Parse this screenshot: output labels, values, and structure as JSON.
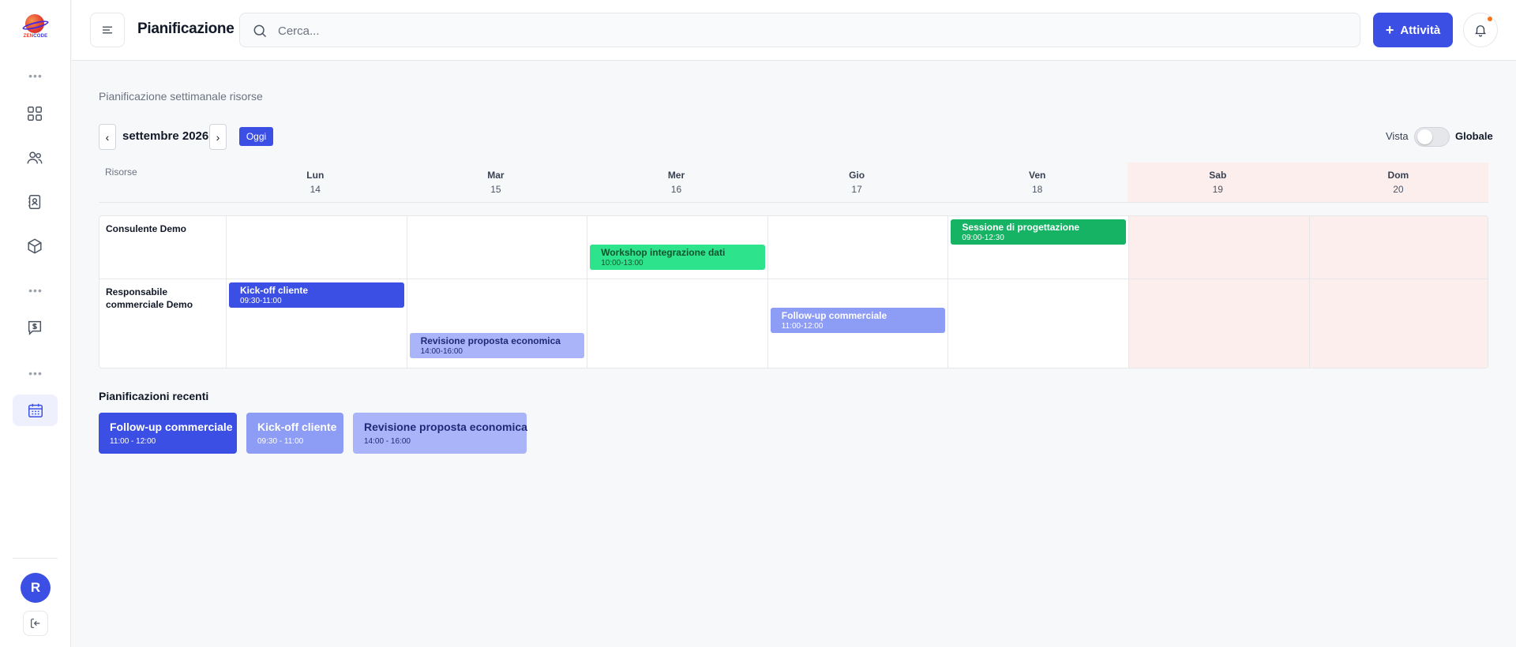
{
  "app": {
    "logo_text_a": "ZEN",
    "logo_text_b": "CODE"
  },
  "header": {
    "title": "Pianificazione",
    "search_placeholder": "Cerca...",
    "activity_label": "Attività"
  },
  "sidebar": {
    "avatar_initial": "R",
    "icons": [
      "grid-icon",
      "users-icon",
      "contacts-icon",
      "package-icon",
      "billing-icon",
      "calendar-icon"
    ]
  },
  "planner": {
    "subtitle": "Pianificazione settimanale risorse",
    "prev_label": "‹",
    "next_label": "›",
    "month_label": "settembre 2026",
    "today_label": "Oggi",
    "view_label": "Vista",
    "global_label": "Globale",
    "resources_header": "Risorse",
    "days": [
      {
        "name": "Lun",
        "num": "14",
        "weekend": false
      },
      {
        "name": "Mar",
        "num": "15",
        "weekend": false
      },
      {
        "name": "Mer",
        "num": "16",
        "weekend": false
      },
      {
        "name": "Gio",
        "num": "17",
        "weekend": false
      },
      {
        "name": "Ven",
        "num": "18",
        "weekend": false
      },
      {
        "name": "Sab",
        "num": "19",
        "weekend": true
      },
      {
        "name": "Dom",
        "num": "20",
        "weekend": true
      }
    ],
    "resources": [
      {
        "name": "Consulente Demo",
        "events": [
          {
            "title": "Workshop integrazione dati",
            "time": "10:00-13:00",
            "day": 2,
            "color": "#2de38c",
            "text_color": "#14532d"
          },
          {
            "title": "Sessione di progettazione",
            "time": "09:00-12:30",
            "day": 4,
            "color": "#16b364",
            "text_color": "#ffffff"
          }
        ]
      },
      {
        "name": "Responsabile commerciale Demo",
        "events": [
          {
            "title": "Kick-off cliente",
            "time": "09:30-11:00",
            "day": 0,
            "color": "#3b4fe4",
            "text_color": "#ffffff"
          },
          {
            "title": "Revisione proposta economica",
            "time": "14:00-16:00",
            "day": 1,
            "color": "#aab4f8",
            "text_color": "#1e2a78"
          },
          {
            "title": "Follow-up commerciale",
            "time": "11:00-12:00",
            "day": 3,
            "color": "#8d9cf4",
            "text_color": "#ffffff"
          }
        ]
      }
    ]
  },
  "recent": {
    "title": "Pianificazioni recenti",
    "items": [
      {
        "title": "Follow-up commerciale",
        "time": "11:00 - 12:00",
        "color": "#3b4fe4",
        "text_color": "#ffffff"
      },
      {
        "title": "Kick-off cliente",
        "time": "09:30 - 11:00",
        "color": "#8d9cf4",
        "text_color": "#ffffff"
      },
      {
        "title": "Revisione proposta economica",
        "time": "14:00 - 16:00",
        "color": "#aab4f8",
        "text_color": "#1e2a78"
      }
    ]
  }
}
